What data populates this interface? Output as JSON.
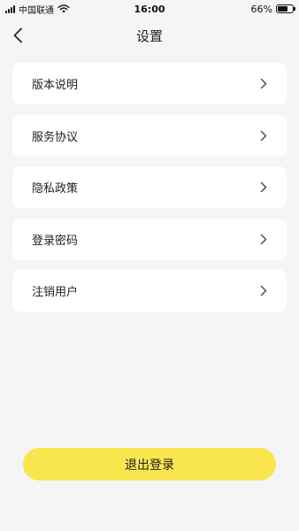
{
  "status_bar": {
    "carrier": "中国联通",
    "time": "16:00",
    "battery": "66%",
    "battery_level": 0.66,
    "icons": [
      "signal-icon",
      "wifi-icon",
      "battery-icon"
    ]
  },
  "nav": {
    "title": "设置",
    "back_icon": "chevron-left-icon"
  },
  "menu": {
    "items": [
      {
        "label": "版本说明",
        "icon": "chevron-right-icon"
      },
      {
        "label": "服务协议",
        "icon": "chevron-right-icon"
      },
      {
        "label": "隐私政策",
        "icon": "chevron-right-icon"
      },
      {
        "label": "登录密码",
        "icon": "chevron-right-icon"
      },
      {
        "label": "注销用户",
        "icon": "chevron-right-icon"
      }
    ]
  },
  "logout": {
    "label": "退出登录"
  },
  "colors": {
    "background": "#f5f5f5",
    "card": "#ffffff",
    "accent": "#f9e64f",
    "text": "#222222"
  }
}
